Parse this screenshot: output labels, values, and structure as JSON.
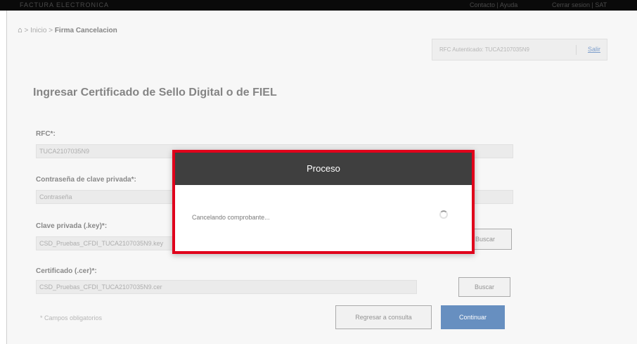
{
  "header": {
    "brand": "FACTURA ELECTRONICA",
    "link_contact": "Contacto | Ayuda",
    "link_session": "Cerrar sesion | SAT"
  },
  "breadcrumb": {
    "home_icon": "home-icon",
    "inicio": "Inicio",
    "separator": ">",
    "current": "Firma Cancelacion"
  },
  "rfc_box": {
    "text": "RFC Autenticado: TUCA2107035N9",
    "link": "Salir"
  },
  "form": {
    "title": "Ingresar Certificado de Sello Digital o de FIEL",
    "rfc_label": "RFC*:",
    "rfc_value": "TUCA2107035N9",
    "password_label": "Contraseña de clave privada*:",
    "password_placeholder": "Contraseña",
    "key_label": "Clave privada (.key)*:",
    "key_value": "CSD_Pruebas_CFDI_TUCA2107035N9.key",
    "cert_label": "Certificado (.cer)*:",
    "cert_value": "CSD_Pruebas_CFDI_TUCA2107035N9.cer",
    "buscar_label": "Buscar",
    "required_note": "* Campos obligatorios",
    "back_label": "Regresar a consulta",
    "continue_label": "Continuar"
  },
  "modal": {
    "title": "Proceso",
    "message": "Cancelando comprobante..."
  }
}
